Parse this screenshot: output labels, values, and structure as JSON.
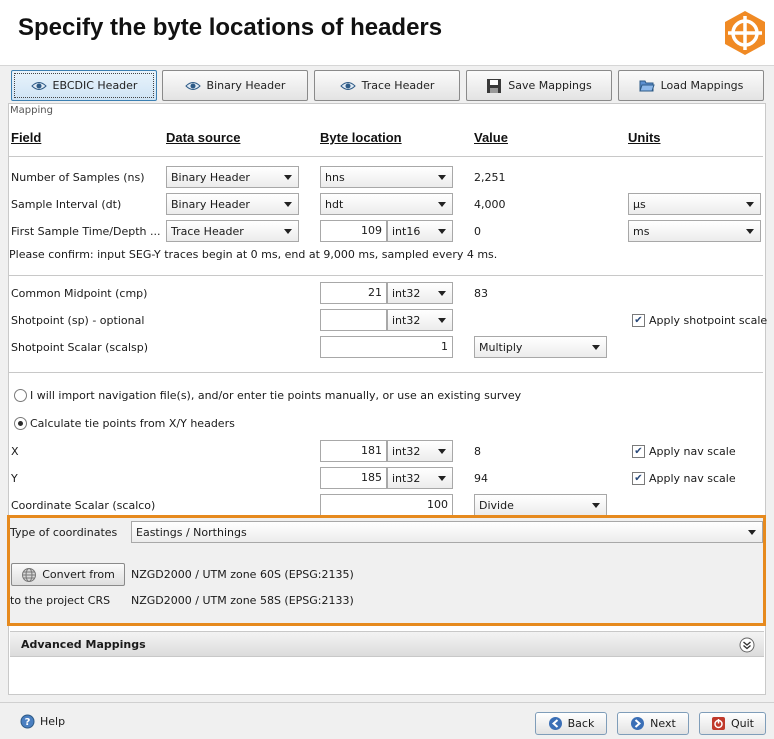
{
  "header": {
    "title": "Specify the byte locations of headers"
  },
  "toolbar": {
    "ebcdic": "EBCDIC Header",
    "binary": "Binary Header",
    "trace": "Trace Header",
    "save": "Save Mappings",
    "load": "Load Mappings"
  },
  "panel_title": "Mapping",
  "columns": {
    "field": "Field",
    "source": "Data source",
    "byte": "Byte location",
    "value": "Value",
    "units": "Units"
  },
  "rows": {
    "ns": {
      "label": "Number of Samples (ns)",
      "source": "Binary Header",
      "byte": "hns",
      "value": "2,251"
    },
    "dt": {
      "label": "Sample Interval (dt)",
      "source": "Binary Header",
      "byte": "hdt",
      "value": "4,000",
      "units": "µs"
    },
    "fst": {
      "label": "First Sample Time/Depth ...",
      "source": "Trace Header",
      "byte": "109",
      "type": "int16",
      "value": "0",
      "units": "ms"
    },
    "confirm": "Please confirm: input SEG-Y traces begin at 0 ms, end at 9,000 ms, sampled every 4 ms.",
    "cmp": {
      "label": "Common Midpoint (cmp)",
      "byte": "21",
      "type": "int32",
      "value": "83"
    },
    "sp": {
      "label": "Shotpoint (sp) - optional",
      "byte": "",
      "type": "int32",
      "check": "Apply shotpoint scale"
    },
    "scalsp": {
      "label": "Shotpoint Scalar (scalsp)",
      "byte": "1",
      "op": "Multiply"
    },
    "radio1": "I will import navigation file(s), and/or enter tie points manually, or use an existing survey",
    "radio2": "Calculate tie points from X/Y headers",
    "x": {
      "label": "X",
      "byte": "181",
      "type": "int32",
      "value": "8",
      "check": "Apply nav scale"
    },
    "y": {
      "label": "Y",
      "byte": "185",
      "type": "int32",
      "value": "94",
      "check": "Apply nav scale"
    },
    "scalco": {
      "label": "Coordinate Scalar (scalco)",
      "byte": "100",
      "op": "Divide"
    }
  },
  "coords": {
    "type_label": "Type of coordinates",
    "type_value": "Eastings / Northings",
    "convert_button": "Convert from",
    "from_crs": "NZGD2000 / UTM zone 60S (EPSG:2135)",
    "to_label": "to the project CRS",
    "to_crs": "NZGD2000 / UTM zone 58S (EPSG:2133)"
  },
  "advanced": "Advanced Mappings",
  "footer": {
    "help": "Help",
    "back": "Back",
    "next": "Next",
    "quit": "Quit"
  },
  "colors": {
    "accent": "#e68a1e",
    "logo": "#f08a24"
  }
}
